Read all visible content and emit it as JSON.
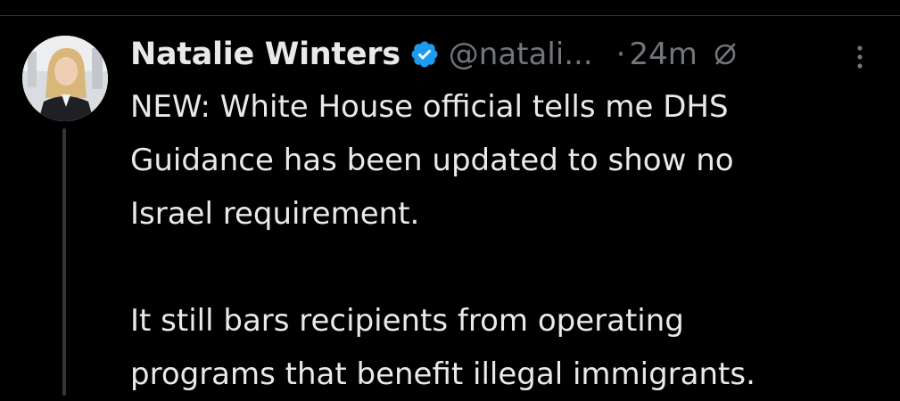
{
  "tweet": {
    "author": {
      "display_name": "Natalie Winters",
      "handle": "@natali...",
      "verified": true,
      "avatar_icon": "profile-photo"
    },
    "separator": "·",
    "timestamp": "24m",
    "text_lines": [
      "NEW: White House official tells me DHS",
      "Guidance has been updated to show no",
      "Israel requirement.",
      "",
      "It still bars recipients from operating",
      "programs that benefit illegal immigrants."
    ]
  },
  "colors": {
    "background": "#000000",
    "primary_text": "#e7e9ea",
    "secondary_text": "#71767b",
    "verified_blue": "#1d9bf0",
    "thread_line": "#333639"
  },
  "icons": {
    "verified": "verified-badge-icon",
    "restricted": "reply-restricted-icon",
    "more": "more-options-icon"
  }
}
